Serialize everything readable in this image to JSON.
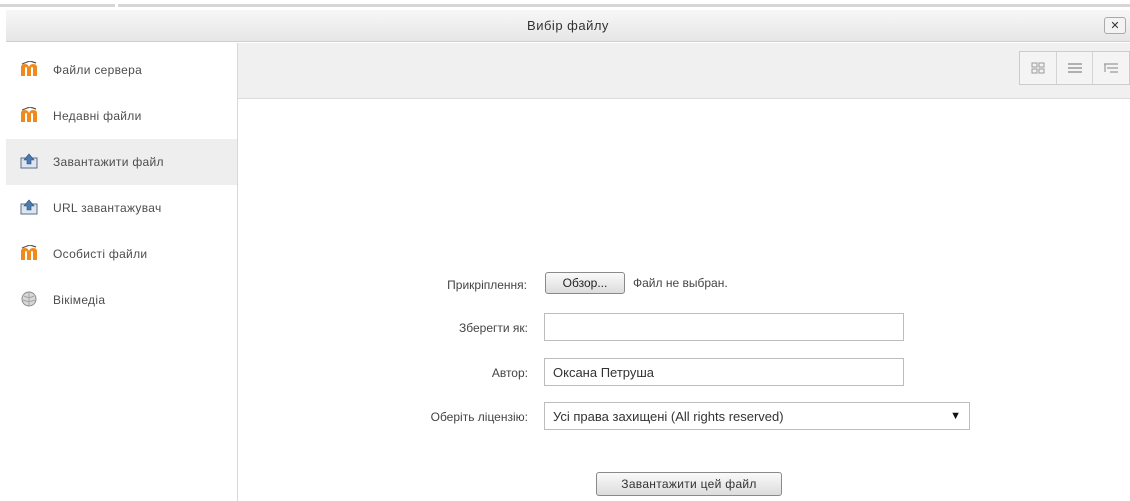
{
  "dialog": {
    "title": "Вибір файлу",
    "close_label": "✕"
  },
  "sidebar": {
    "items": [
      {
        "label": "Файли сервера",
        "icon": "moodle-icon"
      },
      {
        "label": "Недавні файли",
        "icon": "moodle-icon"
      },
      {
        "label": "Завантажити файл",
        "icon": "upload-icon",
        "active": true
      },
      {
        "label": "URL завантажувач",
        "icon": "upload-icon"
      },
      {
        "label": "Особисті файли",
        "icon": "moodle-icon"
      },
      {
        "label": "Вікімедіа",
        "icon": "wikimedia-icon"
      }
    ]
  },
  "toolbar": {
    "view_buttons": [
      "grid-view-icon",
      "list-view-icon",
      "tree-view-icon"
    ]
  },
  "form": {
    "attachment_label": "Прикріплення:",
    "browse_button": "Обзор...",
    "no_file_text": "Файл не выбран.",
    "save_as_label": "Зберегти як:",
    "save_as_value": "",
    "author_label": "Автор:",
    "author_value": "Оксана Петруша",
    "license_label": "Оберіть ліцензію:",
    "license_value": "Усі права захищені (All rights reserved)",
    "submit_button": "Завантажити цей файл"
  },
  "colors": {
    "moodle_orange": "#f08a1c",
    "active_item_bg": "#eeeeee",
    "toolbar_bg": "#f0f0f0"
  }
}
